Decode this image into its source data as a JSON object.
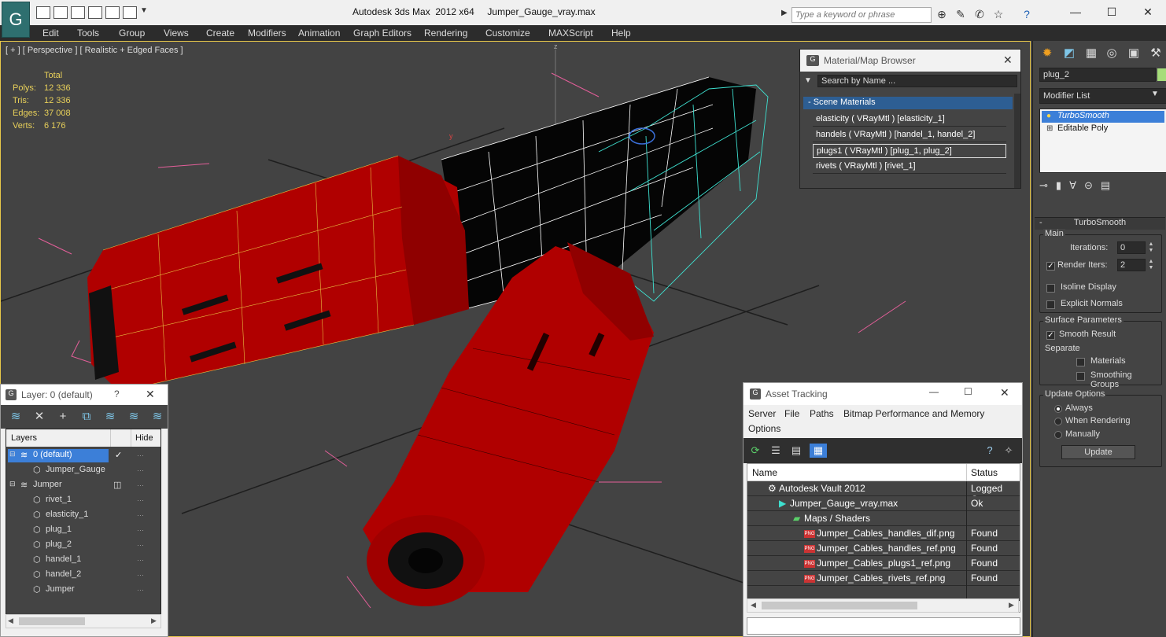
{
  "app": {
    "title_text": "Autodesk 3ds Max  2012 x64     Jumper_Gauge_vray.max",
    "search_placeholder": "Type a keyword or phrase"
  },
  "menu": [
    "Edit",
    "Tools",
    "Group",
    "Views",
    "Create",
    "Modifiers",
    "Animation",
    "Graph Editors",
    "Rendering",
    "Customize",
    "MAXScript",
    "Help"
  ],
  "viewport": {
    "label": "[ + ] [ Perspective ] [ Realistic + Edged Faces ]",
    "stats": {
      "header": "Total",
      "rows": [
        {
          "label": "Polys:",
          "value": "12 336"
        },
        {
          "label": "Tris:",
          "value": "12 336"
        },
        {
          "label": "Edges:",
          "value": "37 008"
        },
        {
          "label": "Verts:",
          "value": "6 176"
        }
      ]
    },
    "axis_label": "z",
    "gizmo_label": "y"
  },
  "command_panel": {
    "object_name": "plug_2",
    "object_color": "#a6dd7a",
    "modifier_list_label": "Modifier List",
    "stack": [
      "TurboSmooth",
      "Editable Poly"
    ],
    "rollout_title": "TurboSmooth",
    "main_group": "Main",
    "iterations_label": "Iterations:",
    "iterations_value": "0",
    "render_iters_label": "Render Iters:",
    "render_iters_value": "2",
    "isoline_label": "Isoline Display",
    "explicit_normals_label": "Explicit Normals",
    "surface_group": "Surface Parameters",
    "smooth_result_label": "Smooth Result",
    "separate_label": "Separate",
    "materials_label": "Materials",
    "smoothing_groups_label": "Smoothing Groups",
    "update_group": "Update Options",
    "always_label": "Always",
    "when_rendering_label": "When Rendering",
    "manually_label": "Manually",
    "update_button": "Update"
  },
  "material_browser": {
    "title": "Material/Map Browser",
    "search_placeholder": "Search by Name ...",
    "section": "- Scene Materials",
    "materials": [
      "elasticity  ( VRayMtl ) [elasticity_1]",
      "handels  ( VRayMtl ) [handel_1, handel_2]",
      "plugs1  ( VRayMtl ) [plug_1, plug_2]",
      "rivets  ( VRayMtl ) [rivet_1]"
    ]
  },
  "layer_explorer": {
    "title": "Layer: 0 (default)",
    "help": "?",
    "col_layers": "Layers",
    "col_hide": "Hide",
    "rows": [
      {
        "name": "0 (default)",
        "indent": 0
      },
      {
        "name": "Jumper_Gauge",
        "indent": 1
      },
      {
        "name": "Jumper",
        "indent": 0
      },
      {
        "name": "rivet_1",
        "indent": 1
      },
      {
        "name": "elasticity_1",
        "indent": 1
      },
      {
        "name": "plug_1",
        "indent": 1
      },
      {
        "name": "plug_2",
        "indent": 1
      },
      {
        "name": "handel_1",
        "indent": 1
      },
      {
        "name": "handel_2",
        "indent": 1
      },
      {
        "name": "Jumper",
        "indent": 1
      }
    ]
  },
  "asset_tracking": {
    "title": "Asset Tracking",
    "menus": [
      "Server",
      "File",
      "Paths",
      "Bitmap Performance and Memory",
      "Options"
    ],
    "col_name": "Name",
    "col_status": "Status",
    "rows": [
      {
        "name": "Autodesk Vault 2012",
        "status": "Logged Out"
      },
      {
        "name": "Jumper_Gauge_vray.max",
        "status": "Ok"
      },
      {
        "name": "Maps / Shaders",
        "status": ""
      },
      {
        "name": "Jumper_Cables_handles_dif.png",
        "status": "Found"
      },
      {
        "name": "Jumper_Cables_handles_ref.png",
        "status": "Found"
      },
      {
        "name": "Jumper_Cables_plugs1_ref.png",
        "status": "Found"
      },
      {
        "name": "Jumper_Cables_rivets_ref.png",
        "status": "Found"
      }
    ]
  }
}
